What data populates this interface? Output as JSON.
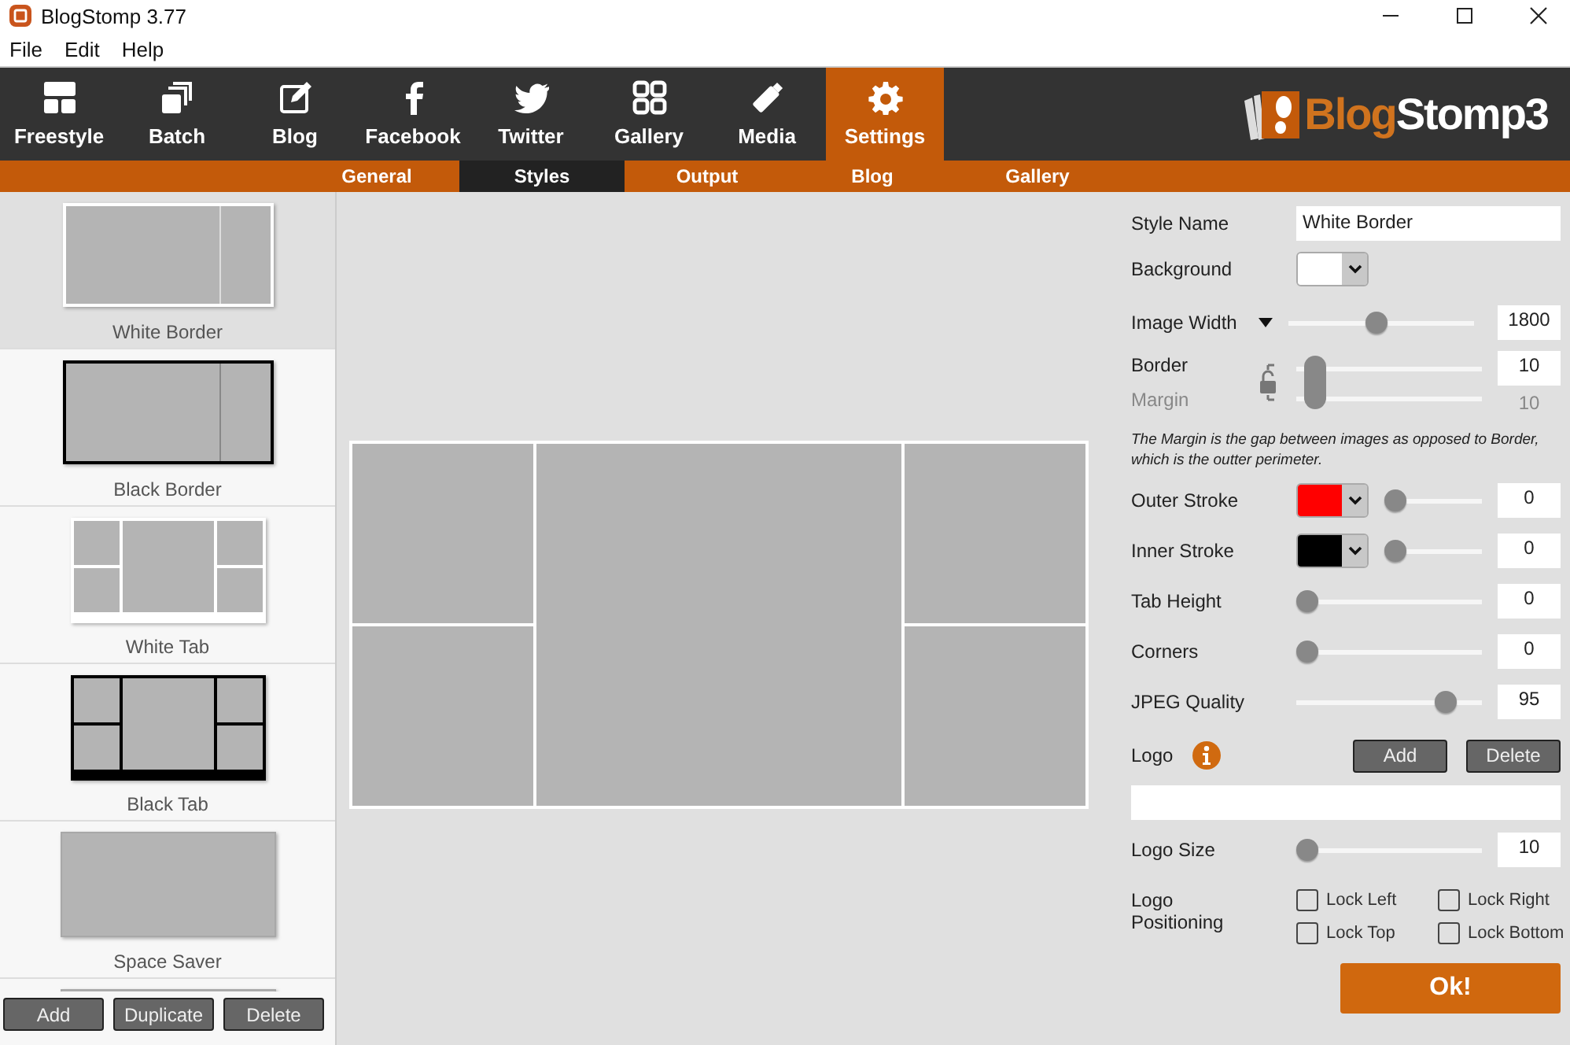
{
  "window": {
    "title": "BlogStomp 3.77"
  },
  "menu": [
    "File",
    "Edit",
    "Help"
  ],
  "nav": [
    {
      "label": "Freestyle",
      "selected": false
    },
    {
      "label": "Batch",
      "selected": false
    },
    {
      "label": "Blog",
      "selected": false
    },
    {
      "label": "Facebook",
      "selected": false
    },
    {
      "label": "Twitter",
      "selected": false
    },
    {
      "label": "Gallery",
      "selected": false
    },
    {
      "label": "Media",
      "selected": false
    },
    {
      "label": "Settings",
      "selected": true
    }
  ],
  "logo": {
    "first": "Blog",
    "second": "Stomp3"
  },
  "subtabs": [
    {
      "label": "General",
      "selected": false
    },
    {
      "label": "Styles",
      "selected": true
    },
    {
      "label": "Output",
      "selected": false
    },
    {
      "label": "Blog",
      "selected": false
    },
    {
      "label": "Gallery",
      "selected": false
    }
  ],
  "styles": [
    {
      "name": "White Border",
      "kind": "white-border",
      "selected": true
    },
    {
      "name": "Black Border",
      "kind": "black-border",
      "selected": false
    },
    {
      "name": "White Tab",
      "kind": "white-tab",
      "selected": false
    },
    {
      "name": "Black Tab",
      "kind": "black-tab",
      "selected": false
    },
    {
      "name": "Space Saver",
      "kind": "space-saver",
      "selected": false
    },
    {
      "kind": "space-saver",
      "selected": false
    }
  ],
  "style_buttons": [
    "Add",
    "Duplicate",
    "Delete"
  ],
  "settings": {
    "style_name": {
      "label": "Style Name",
      "value": "White Border"
    },
    "background": {
      "label": "Background",
      "color": "#ffffff"
    },
    "image_width": {
      "label": "Image Width",
      "level": 0.47,
      "value": "1800"
    },
    "border_margin": {
      "locked": true,
      "level": 0.05,
      "border": {
        "label": "Border",
        "value": "10"
      },
      "margin": {
        "label": "Margin",
        "value": "10",
        "disabled": true
      }
    },
    "note": "The Margin is the gap between images as opposed to Border, which is the outter perimeter.",
    "rows": [
      {
        "kind": "color-slider",
        "label": "Outer Stroke",
        "color": "#ff0000",
        "level": 0,
        "value": "0"
      },
      {
        "kind": "color-slider",
        "label": "Inner Stroke",
        "color": "#000000",
        "level": 0,
        "value": "0"
      },
      {
        "kind": "slider",
        "label": "Tab Height",
        "level": 0,
        "value": "0"
      },
      {
        "kind": "slider",
        "label": "Corners",
        "level": 0,
        "value": "0"
      },
      {
        "kind": "slider",
        "label": "JPEG Quality",
        "level": 0.85,
        "value": "95"
      }
    ],
    "logo": {
      "label": "Logo",
      "buttons": [
        "Add",
        "Delete"
      ]
    },
    "logo_size": {
      "label": "Logo Size",
      "level": 0,
      "value": "10"
    },
    "positioning": {
      "label": "Logo Positioning",
      "options": [
        {
          "label": "Lock Left",
          "checked": false
        },
        {
          "label": "Lock Right",
          "checked": false
        },
        {
          "label": "Lock Top",
          "checked": false
        },
        {
          "label": "Lock Bottom",
          "checked": false
        }
      ]
    },
    "ok": "Ok!"
  }
}
